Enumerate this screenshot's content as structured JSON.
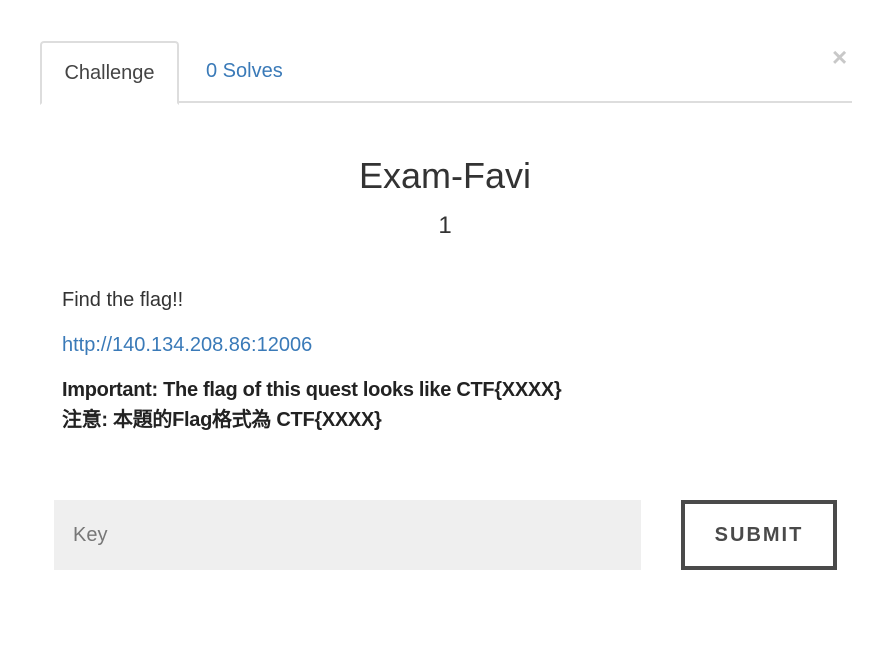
{
  "modal": {
    "close_label": "×"
  },
  "tabs": [
    {
      "label": "Challenge",
      "active": true
    },
    {
      "label": "0 Solves",
      "active": false
    }
  ],
  "challenge": {
    "name": "Exam-Favi",
    "points": "1",
    "description": {
      "line1": "Find the flag!!",
      "link": "http://140.134.208.86:12006",
      "important_en": "Important: The flag of this quest looks like CTF{XXXX}",
      "important_zh": "注意: 本題的Flag格式為 CTF{XXXX}"
    }
  },
  "submission": {
    "key_placeholder": "Key",
    "key_value": "",
    "submit_label": "SUBMIT"
  },
  "colors": {
    "link": "#3a7ab8",
    "text": "#333333",
    "input_bg": "#efefef",
    "button_border": "#4a4a4a"
  }
}
